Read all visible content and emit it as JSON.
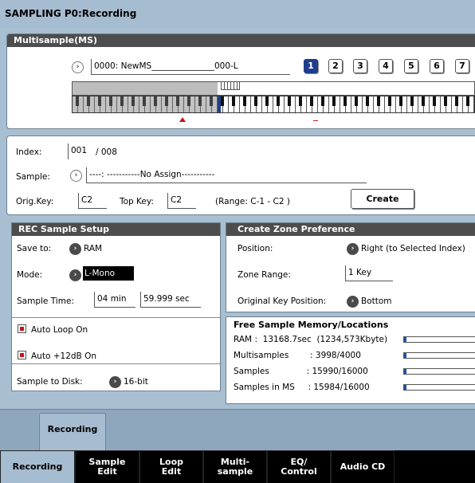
{
  "title": "SAMPLING P0:Recording",
  "multisample": {
    "header": "Multisample(MS)",
    "name": "0000: NewMS_______________000-L",
    "index_buttons": [
      "1",
      "2",
      "3",
      "4",
      "5",
      "6",
      "7"
    ],
    "selected_button": "1"
  },
  "index_section": {
    "index_label": "Index:",
    "index_value": "001",
    "index_total": "/ 008",
    "sample_label": "Sample:",
    "sample_value": "----: -----------No Assign-----------",
    "orig_key_label": "Orig.Key:",
    "orig_key_value": "C2",
    "top_key_label": "Top Key:",
    "top_key_value": "C2",
    "range_text": "(Range:  C-1   - C2    )",
    "create_button": "Create"
  },
  "rec_setup": {
    "header": "REC Sample Setup",
    "save_to_label": "Save to:",
    "save_to_value": "RAM",
    "mode_label": "Mode:",
    "mode_value": "L-Mono",
    "sample_time_label": "Sample Time:",
    "sample_time_min": "04 min",
    "sample_time_sec": "59.999 sec",
    "auto_loop": "Auto Loop On",
    "auto_12db": "Auto +12dB On",
    "sample_to_disk_label": "Sample to Disk:",
    "sample_to_disk_value": "16-bit"
  },
  "zone_pref": {
    "header": "Create Zone Preference",
    "position_label": "Position:",
    "position_value": "Right (to Selected Index)",
    "zone_range_label": "Zone Range:",
    "zone_range_value": "1 Key",
    "orig_key_pos_label": "Original Key Position:",
    "orig_key_pos_value": "Bottom"
  },
  "memory": {
    "header": "Free Sample Memory/Locations",
    "rows": [
      {
        "label": "RAM :  13168.7sec  (1234,573Kbyte)",
        "fill": 0.03
      },
      {
        "label": "Multisamples        : 3998/4000",
        "fill": 0.03
      },
      {
        "label": "Samples              : 15990/16000",
        "fill": 0.03
      },
      {
        "label": "Samples in MS     : 15984/16000",
        "fill": 0.03
      }
    ]
  },
  "page_tab": "Recording",
  "bottom_tabs": [
    "Recording",
    "Sample\nEdit",
    "Loop\nEdit",
    "Multi-\nsample",
    "EQ/\nControl",
    "Audio CD"
  ],
  "colors": {
    "accent": "#1f3d8c",
    "header_bg": "#4d4d4d",
    "chrome": "#a6bcd0"
  }
}
